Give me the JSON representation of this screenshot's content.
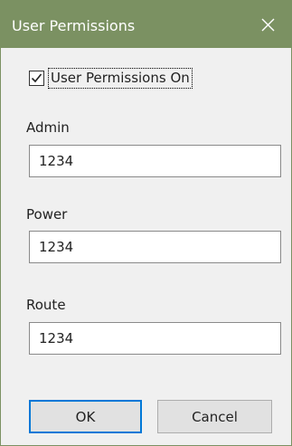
{
  "window": {
    "title": "User Permissions",
    "accent_color": "#7b9162",
    "close_icon": "close-icon"
  },
  "permissions_toggle": {
    "label": "User Permissions On",
    "checked": true
  },
  "fields": {
    "admin": {
      "label": "Admin",
      "value": "1234"
    },
    "power": {
      "label": "Power",
      "value": "1234"
    },
    "route": {
      "label": "Route",
      "value": "1234"
    }
  },
  "buttons": {
    "ok_label": "OK",
    "cancel_label": "Cancel"
  }
}
